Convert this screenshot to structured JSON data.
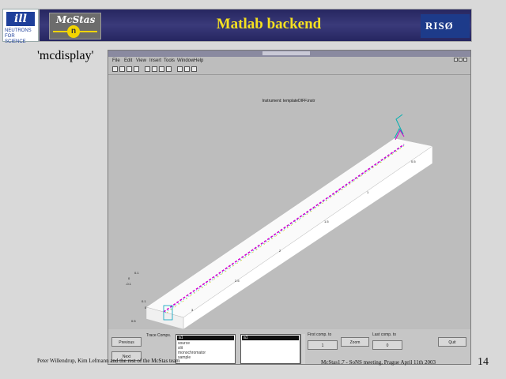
{
  "slide": {
    "title": "Matlab backend",
    "label": "'mcdisplay'",
    "page_number": "14",
    "footer_left": "Peter Willendrup, Kim Lefmann and the rest of the McStas team",
    "footer_right": "McStas1.7 - SoNS meeting, Prague April 11th 2003"
  },
  "logos": {
    "ill_mark": "ill",
    "ill_text": "NEUTRONS FOR SCIENCE",
    "mcstas": "McStas",
    "mcstas_symbol": "n",
    "riso": "RISØ"
  },
  "window": {
    "title": "Instrument display",
    "menu": [
      "File",
      "Edit",
      "View",
      "Insert",
      "Tools",
      "Window",
      "Help"
    ],
    "plot_title": "Instrument: templateDIFF.instr"
  },
  "panel": {
    "buttons": {
      "previous": "Previous",
      "next": "Next",
      "zoom": "Zoom",
      "quit": "Quit",
      "first_component": "First component",
      "last_component": "Last component"
    },
    "labels": {
      "trace_comps": "Trace Comps.",
      "first_to": "First comp. to",
      "last_to": "Last comp. to"
    },
    "component_list": [
      "a1",
      "source",
      "slit",
      "monochromator",
      "sample"
    ],
    "target_list": [
      "a1"
    ],
    "small_values": {
      "first": "1",
      "last": "0"
    }
  },
  "colors": {
    "banner": "#2e2e6e",
    "title": "#f5e020",
    "ray_magenta": "#d000d0",
    "ray_cyan": "#00c0c0",
    "ray_yellow": "#e0c000"
  }
}
